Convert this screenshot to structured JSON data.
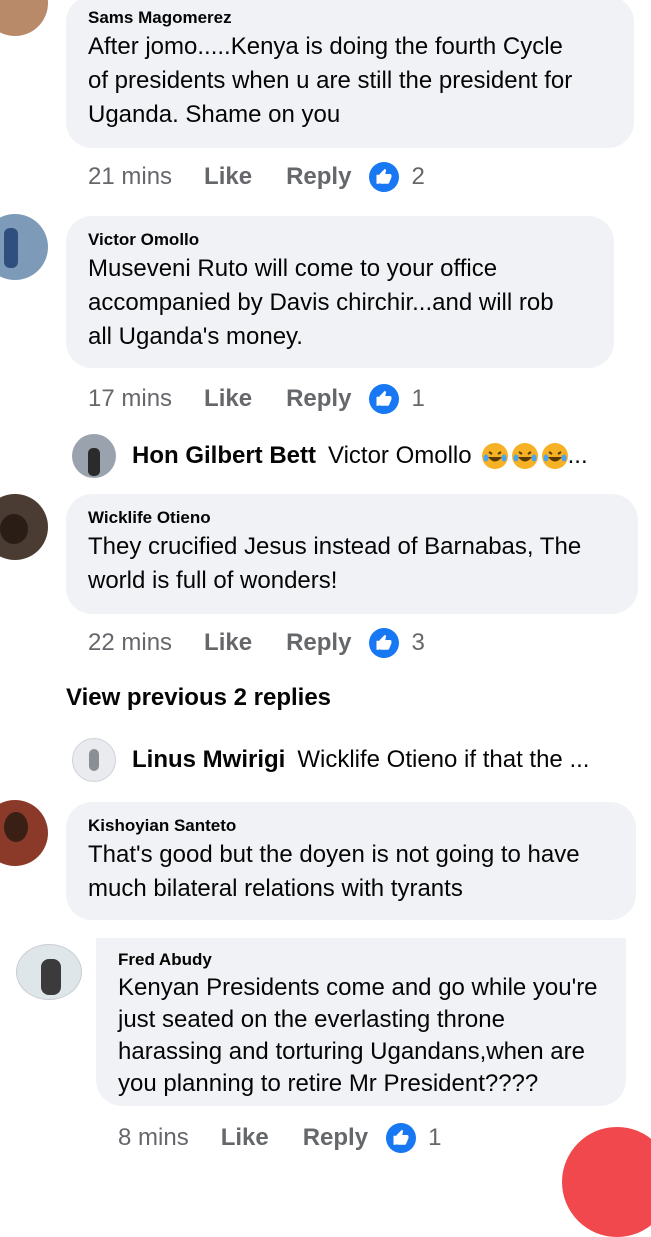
{
  "comments": [
    {
      "author": "Sams Magomerez",
      "lines": [
        "After jomo.....Kenya is doing the fourth Cycle",
        "of presidents when u are still the president for",
        "Uganda. Shame on you"
      ],
      "time": "21 mins",
      "like": "Like",
      "reply": "Reply",
      "likes": "2"
    },
    {
      "author": "Victor Omollo",
      "lines": [
        "Museveni Ruto will come to your office",
        "accompanied by Davis chirchir...and will rob",
        "all Uganda's money."
      ],
      "time": "17 mins",
      "like": "Like",
      "reply": "Reply",
      "likes": "1"
    },
    {
      "author": "Wicklife Otieno",
      "lines": [
        "They crucified Jesus instead of Barnabas, The",
        "world is full of wonders!"
      ],
      "time": "22 mins",
      "like": "Like",
      "reply": "Reply",
      "likes": "3"
    },
    {
      "author": "Kishoyian Santeto",
      "lines": [
        "That's good but the doyen is not going to have",
        "much bilateral relations with tyrants"
      ]
    },
    {
      "author": "Fred Abudy",
      "lines": [
        "Kenyan Presidents come and go while you're",
        "just seated on the everlasting throne",
        "harassing and torturing Ugandans,when are",
        "you planning  to retire Mr President????"
      ],
      "time": "8 mins",
      "like": "Like",
      "reply": "Reply",
      "likes": "1"
    }
  ],
  "replies": [
    {
      "author": "Hon Gilbert Bett",
      "text": "Victor Omollo",
      "suffix": "..."
    },
    {
      "author": "Linus Mwirigi",
      "text": "Wicklife Otieno if that the ..."
    }
  ],
  "view_previous": "View previous 2 replies",
  "colors": {
    "bubble": "#f0f2f5",
    "like_blue": "#1877f2",
    "meta_gray": "#65676b",
    "fab": "#f0484c",
    "emoji": "#f7b125"
  },
  "icons": {
    "like": "thumbs-up-icon",
    "reaction": "laughing-face-icon"
  }
}
